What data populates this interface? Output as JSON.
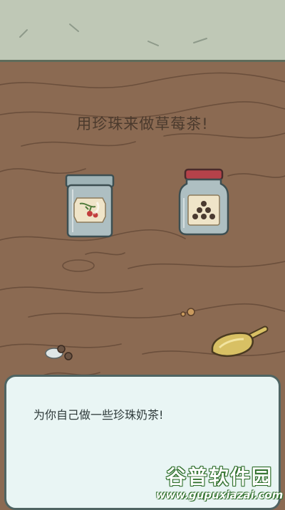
{
  "scene": {
    "headline": "用珍珠来做草莓茶!",
    "items": {
      "tea_jar": "strawberry-tea-tin",
      "pearl_jar": "tapioca-pearl-jar",
      "scoop": "scoop-icon",
      "pearls_on_table": "spilled-pearls"
    }
  },
  "dialog": {
    "text": "为你自己做一些珍珠奶茶!"
  },
  "watermark": {
    "title": "谷普软件园",
    "url": "www.gupuxiazai.com"
  },
  "colors": {
    "wall": "#bfc8b6",
    "table": "#8b6a52",
    "dialog_bg": "#e9f5f4",
    "jar_lid_red": "#b5424a"
  }
}
